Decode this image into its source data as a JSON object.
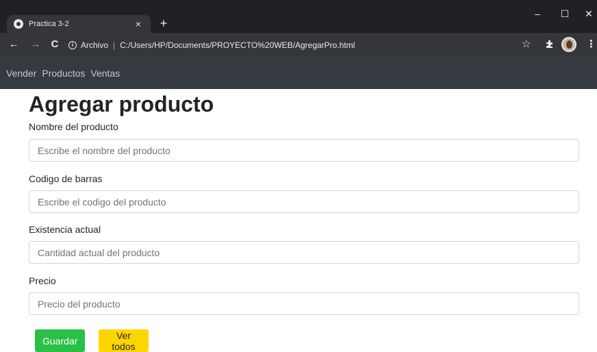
{
  "browser": {
    "tab_title": "Practica 3-2",
    "tab_close": "×",
    "new_tab": "+",
    "win_minimize": "–",
    "win_maximize": "☐",
    "win_close": "✕",
    "back": "←",
    "forward": "→",
    "reload": "C",
    "info": "i",
    "url_scheme": "Archivo",
    "url_separator": "|",
    "url_path": "C:/Users/HP/Documents/PROYECTO%20WEB/AgregarPro.html",
    "star": "☆",
    "menu": "⋮"
  },
  "navbar": {
    "items": [
      "Vender",
      "Productos",
      "Ventas"
    ]
  },
  "form": {
    "title": "Agregar producto",
    "fields": [
      {
        "label": "Nombre del producto",
        "placeholder": "Escribe el nombre del producto",
        "value": ""
      },
      {
        "label": "Codigo de barras",
        "placeholder": "Escribe el codigo del producto",
        "value": ""
      },
      {
        "label": "Existencia actual",
        "placeholder": "Cantidad actual del producto",
        "value": ""
      },
      {
        "label": "Precio",
        "placeholder": "Precio del producto",
        "value": ""
      }
    ],
    "save_label": "Guardar",
    "view_all_label": "Ver todos"
  },
  "colors": {
    "chrome_dark": "#202124",
    "chrome_toolbar": "#35363a",
    "navbar_bg": "#343a40",
    "save_button": "#28c045",
    "view_all_button": "#ffd500"
  }
}
